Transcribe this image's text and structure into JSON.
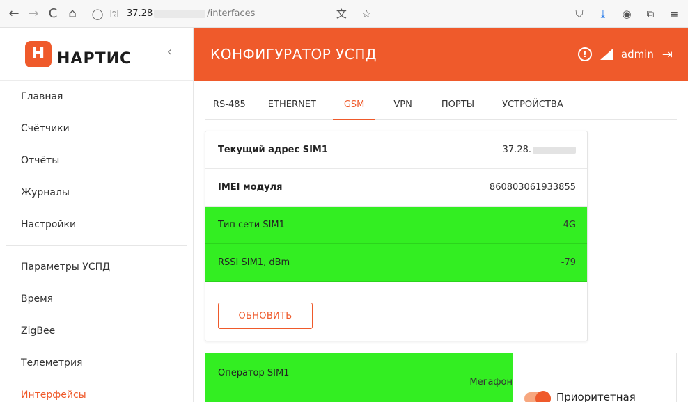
{
  "browser": {
    "back": "←",
    "forward": "→",
    "reload": "C",
    "home": "⌂",
    "url_prefix": "37.28",
    "url_path": "/interfaces"
  },
  "sidebar": {
    "logo_text": "НАРТИС",
    "logo_mark": "Н",
    "collapse": "‹",
    "items_top": [
      {
        "label": "Главная"
      },
      {
        "label": "Счётчики"
      },
      {
        "label": "Отчёты"
      },
      {
        "label": "Журналы"
      },
      {
        "label": "Настройки"
      }
    ],
    "items_bottom": [
      {
        "label": "Параметры УСПД"
      },
      {
        "label": "Время"
      },
      {
        "label": "ZigBee"
      },
      {
        "label": "Телеметрия"
      },
      {
        "label": "Интерфейсы"
      }
    ]
  },
  "header": {
    "title": "КОНФИГУРАТОР УСПД",
    "alert": "!",
    "user": "admin",
    "logout": "⇥"
  },
  "tabs": [
    {
      "label": "RS-485"
    },
    {
      "label": "ETHERNET"
    },
    {
      "label": "GSM"
    },
    {
      "label": "VPN"
    },
    {
      "label": "ПОРТЫ"
    },
    {
      "label": "УСТРОЙСТВА"
    }
  ],
  "gsm": {
    "rows": [
      {
        "label": "Текущий адрес SIM1",
        "value": "37.28."
      },
      {
        "label": "IMEI модуля",
        "value": "860803061933855"
      },
      {
        "label": "Тип сети SIM1",
        "value": "4G"
      },
      {
        "label": "RSSI SIM1, dBm",
        "value": "-79"
      }
    ],
    "update_button": "ОБНОВИТЬ"
  },
  "operator": {
    "label": "Оператор SIM1",
    "value": "Мегафон",
    "priority_label": "Приоритетная"
  },
  "colors": {
    "accent": "#ef5a2b",
    "status_green": "#33ee22"
  }
}
